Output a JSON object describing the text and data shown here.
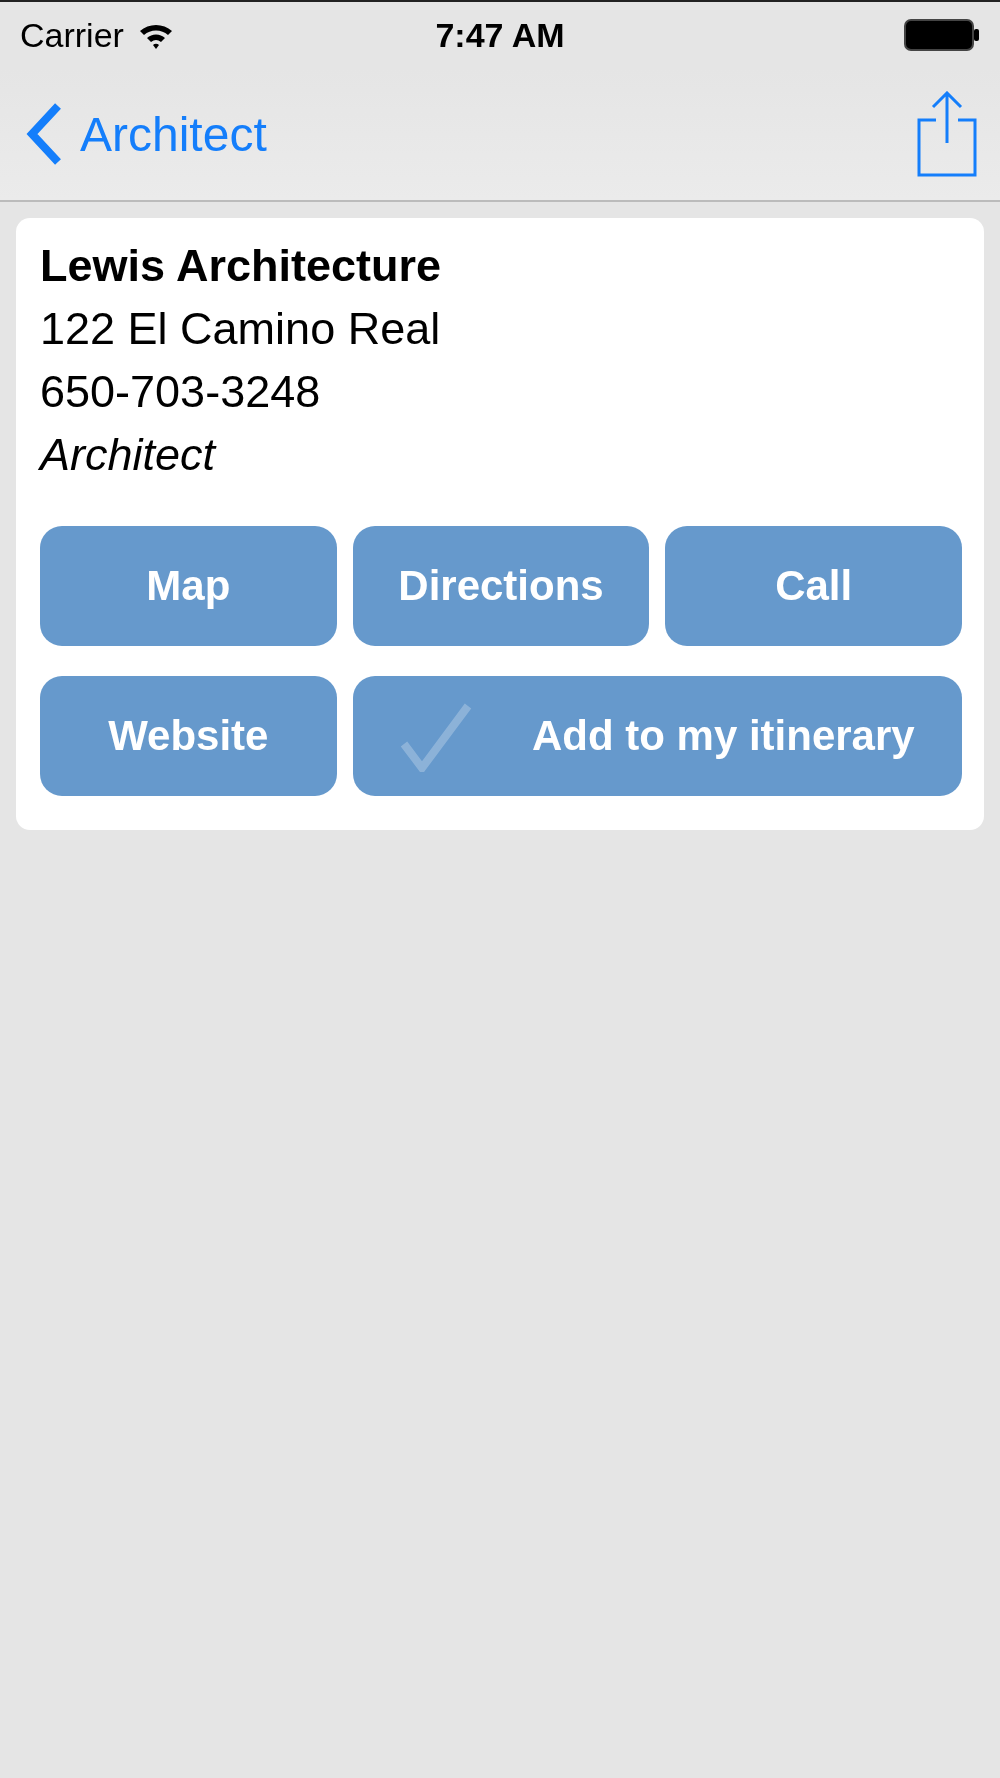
{
  "status_bar": {
    "carrier": "Carrier",
    "time": "7:47 AM"
  },
  "nav_bar": {
    "back_label": "Architect"
  },
  "listing": {
    "name": "Lewis Architecture",
    "address": "122 El Camino Real",
    "phone": "650-703-3248",
    "category": "Architect"
  },
  "buttons": [
    {
      "kind": "action",
      "label": "Map"
    },
    {
      "kind": "action",
      "label": "Directions"
    },
    {
      "kind": "action",
      "label": "Call"
    },
    {
      "kind": "action",
      "label": "Website"
    },
    {
      "kind": "toggle",
      "label": "Add to my itinerary",
      "checked": false
    }
  ]
}
